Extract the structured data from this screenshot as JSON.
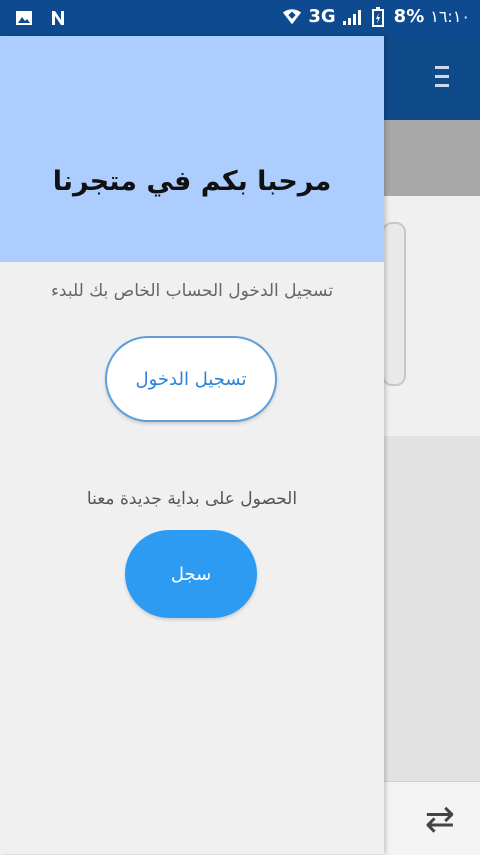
{
  "status_bar": {
    "network": "3G",
    "battery": "8%",
    "time": "١٦:١٠"
  },
  "drawer": {
    "welcome_title": "مرحبا بكم في متجرنا",
    "login_prompt": "تسجيل الدخول الحساب الخاص بك للبدء",
    "login_button": "تسجيل الدخول",
    "signup_prompt": "الحصول على بداية جديدة معنا",
    "signup_button": "سجل"
  },
  "colors": {
    "accent": "#2e9bf2",
    "header": "#aecdff",
    "app_bar": "#0f4a8a"
  }
}
